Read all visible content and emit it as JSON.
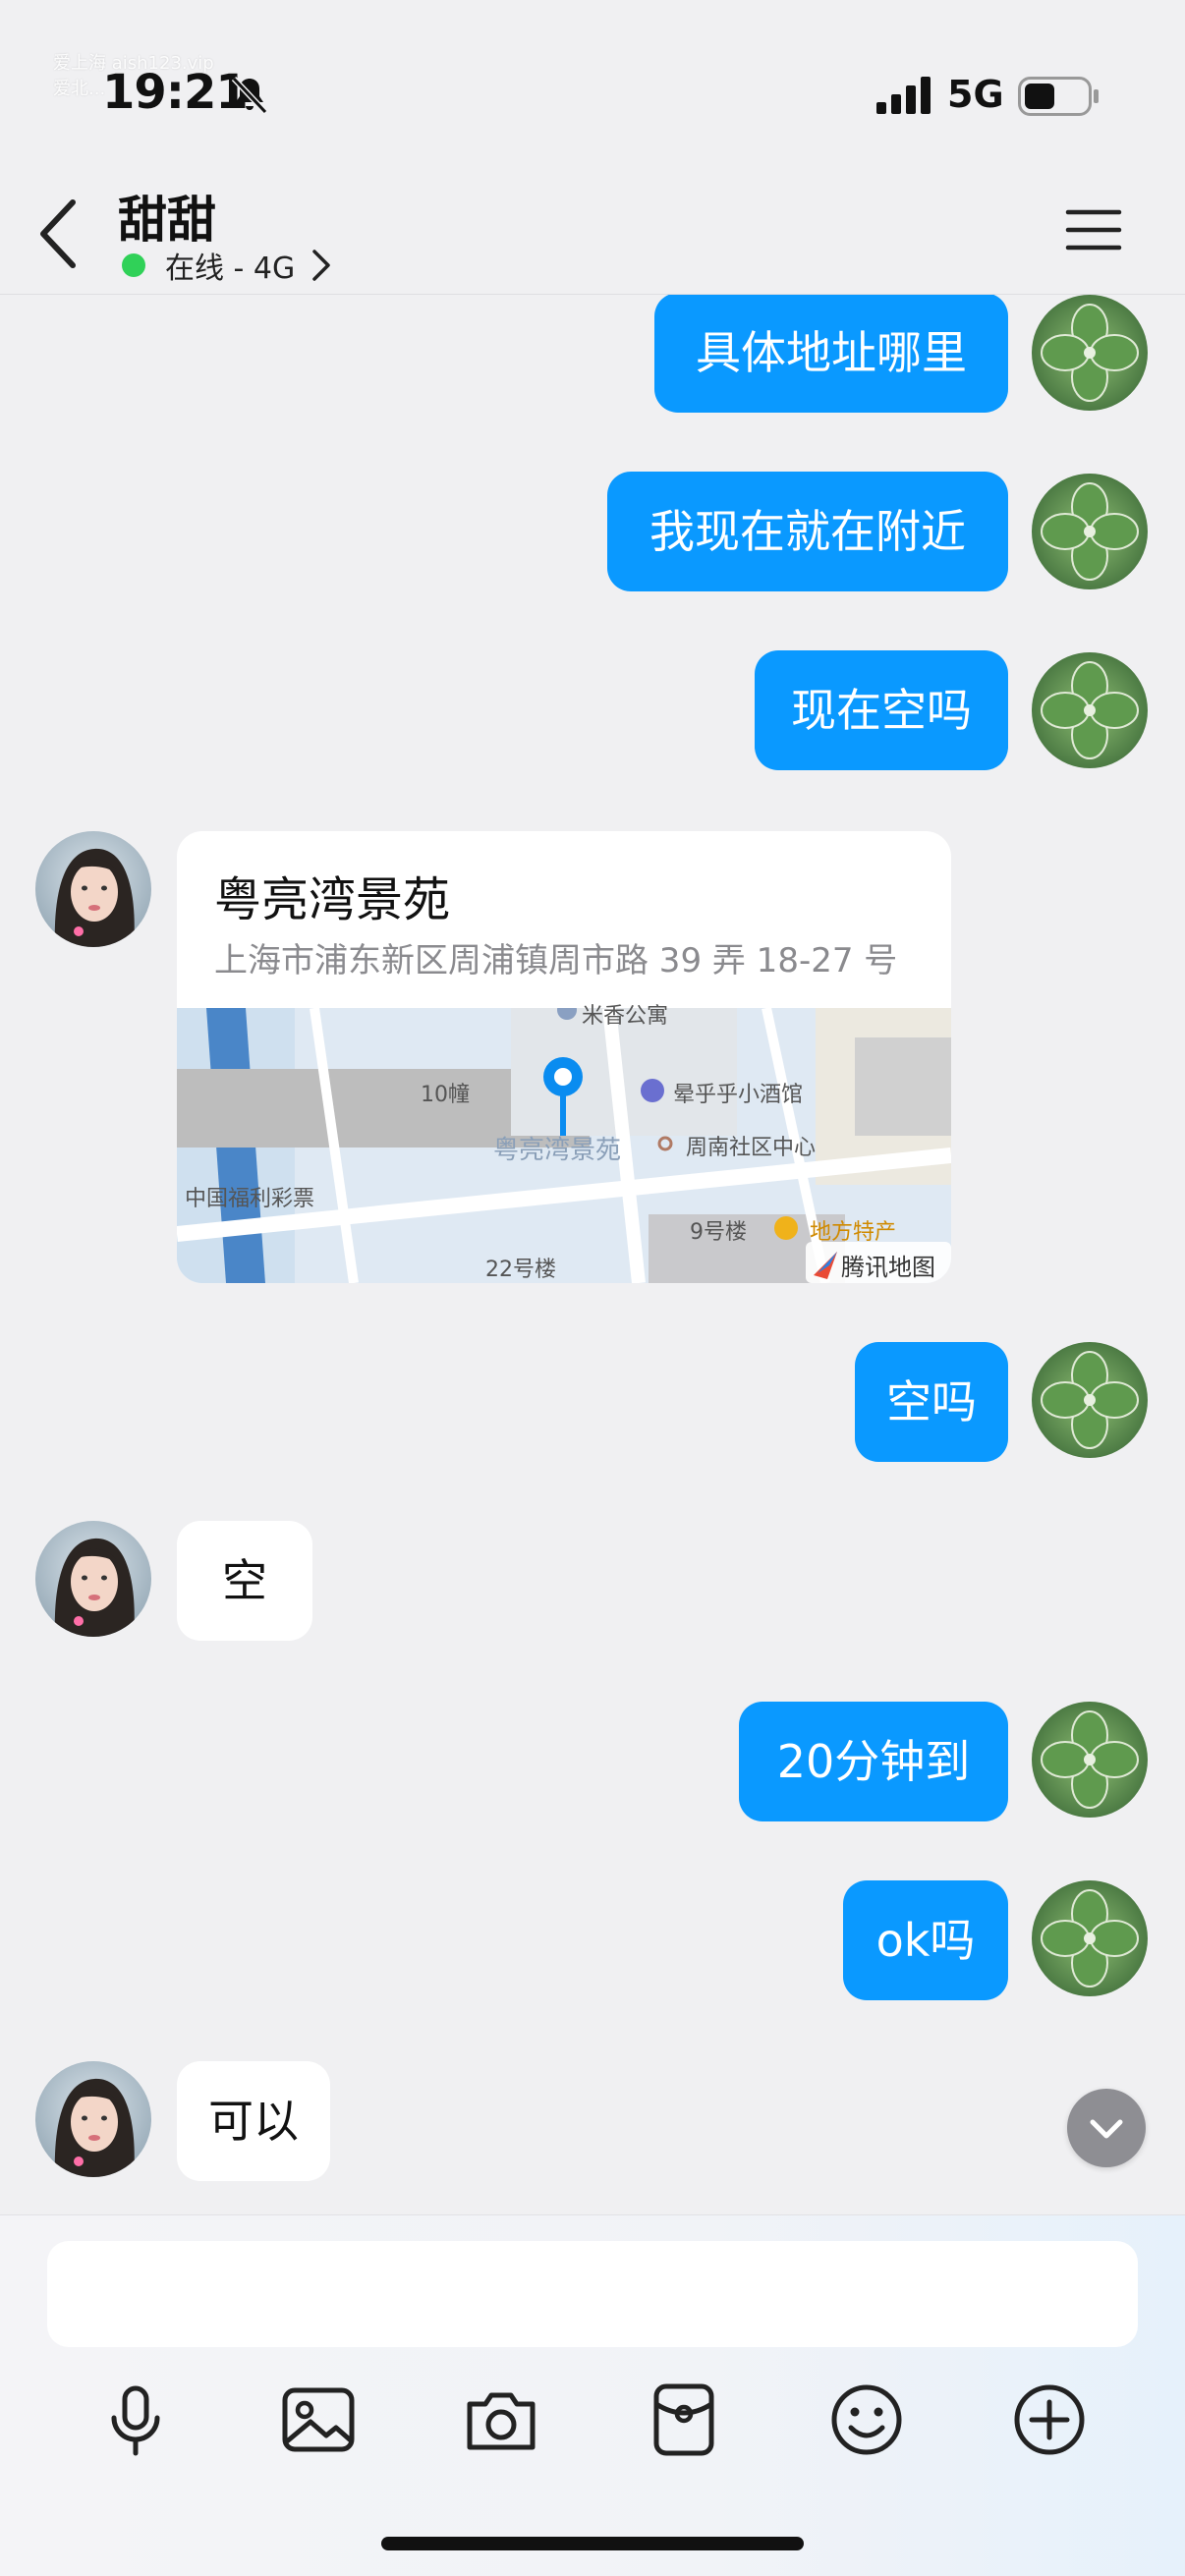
{
  "status": {
    "time": "19:21",
    "network": "5G",
    "watermark_line1": "爱上海 aish123.vip",
    "watermark_line2": "爱北..."
  },
  "header": {
    "contact_name": "甜甜",
    "presence": "在线 - 4G"
  },
  "messages": {
    "m1": "具体地址哪里",
    "m2": "我现在就在附近",
    "m3": "现在空吗",
    "location": {
      "title": "粤亮湾景苑",
      "address": "上海市浦东新区周浦镇周市路 39 弄 18-27 号",
      "map_labels": {
        "top": "米香公寓",
        "building10": "10幢",
        "pin_label": "粤亮湾景苑",
        "bar": "晕乎乎小酒馆",
        "community": "周南社区中心",
        "lottery": "中国福利彩票",
        "building9": "9号楼",
        "specialty": "地方特产",
        "building22": "22号楼",
        "provider": "腾讯地图"
      }
    },
    "m4": "空吗",
    "m5": "空",
    "m6": "20分钟到",
    "m7": "ok吗",
    "m8": "可以"
  },
  "composer": {
    "input_value": "",
    "input_placeholder": ""
  },
  "colors": {
    "bubble_out": "#0a99ff",
    "bubble_in": "#ffffff",
    "online": "#30d158",
    "background": "#f0f0f2"
  }
}
